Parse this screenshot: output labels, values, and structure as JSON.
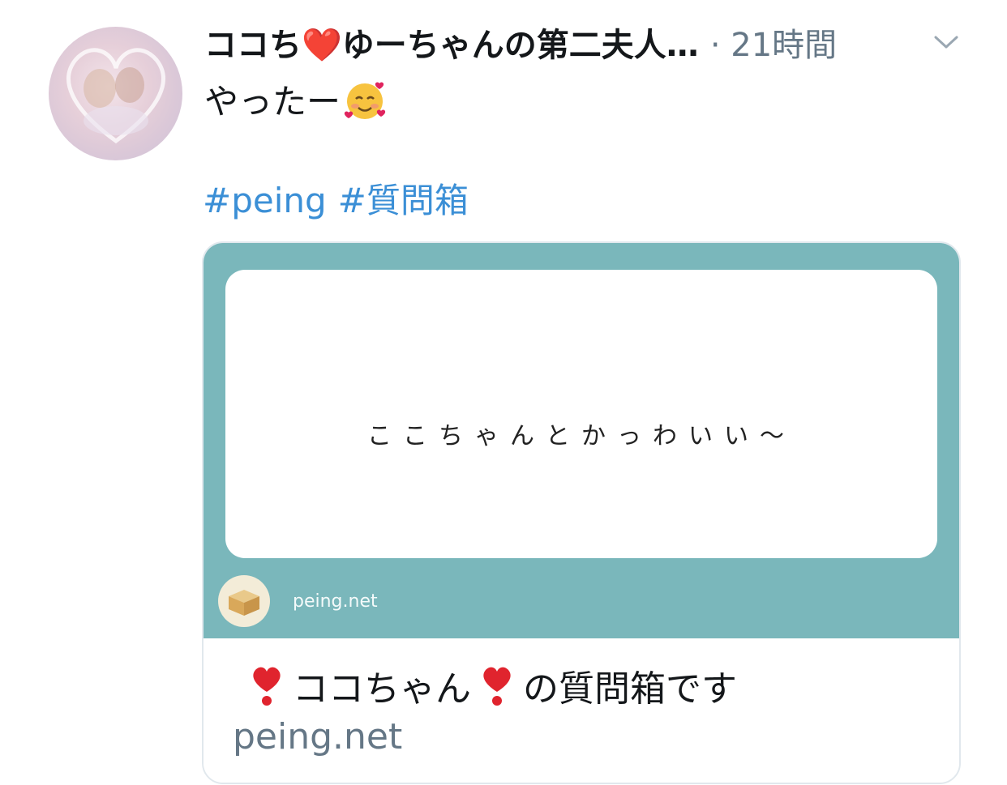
{
  "tweet": {
    "display_name": "ココち❤️ゆーちゃんの第二夫人…",
    "timestamp": "· 21時間",
    "text": "やったー",
    "hashtags": [
      "#peing",
      "#質問箱"
    ]
  },
  "card": {
    "question_text": "ここちゃんとかっわいい〜",
    "site_label": "peing.net",
    "title_name": "ココちゃん",
    "title_suffix": "の質問箱です",
    "domain": "peing.net"
  },
  "icons": {
    "chevron": "chevron-down-icon",
    "emoji": "smiling-face-with-hearts-icon",
    "exclamation": "heavy-heart-exclamation-icon",
    "box": "cardboard-box-icon"
  },
  "colors": {
    "card_teal": "#7ab7bb",
    "hashtag_blue": "#3b8fd6",
    "muted_gray": "#657786",
    "heart_red": "#e0245e"
  }
}
